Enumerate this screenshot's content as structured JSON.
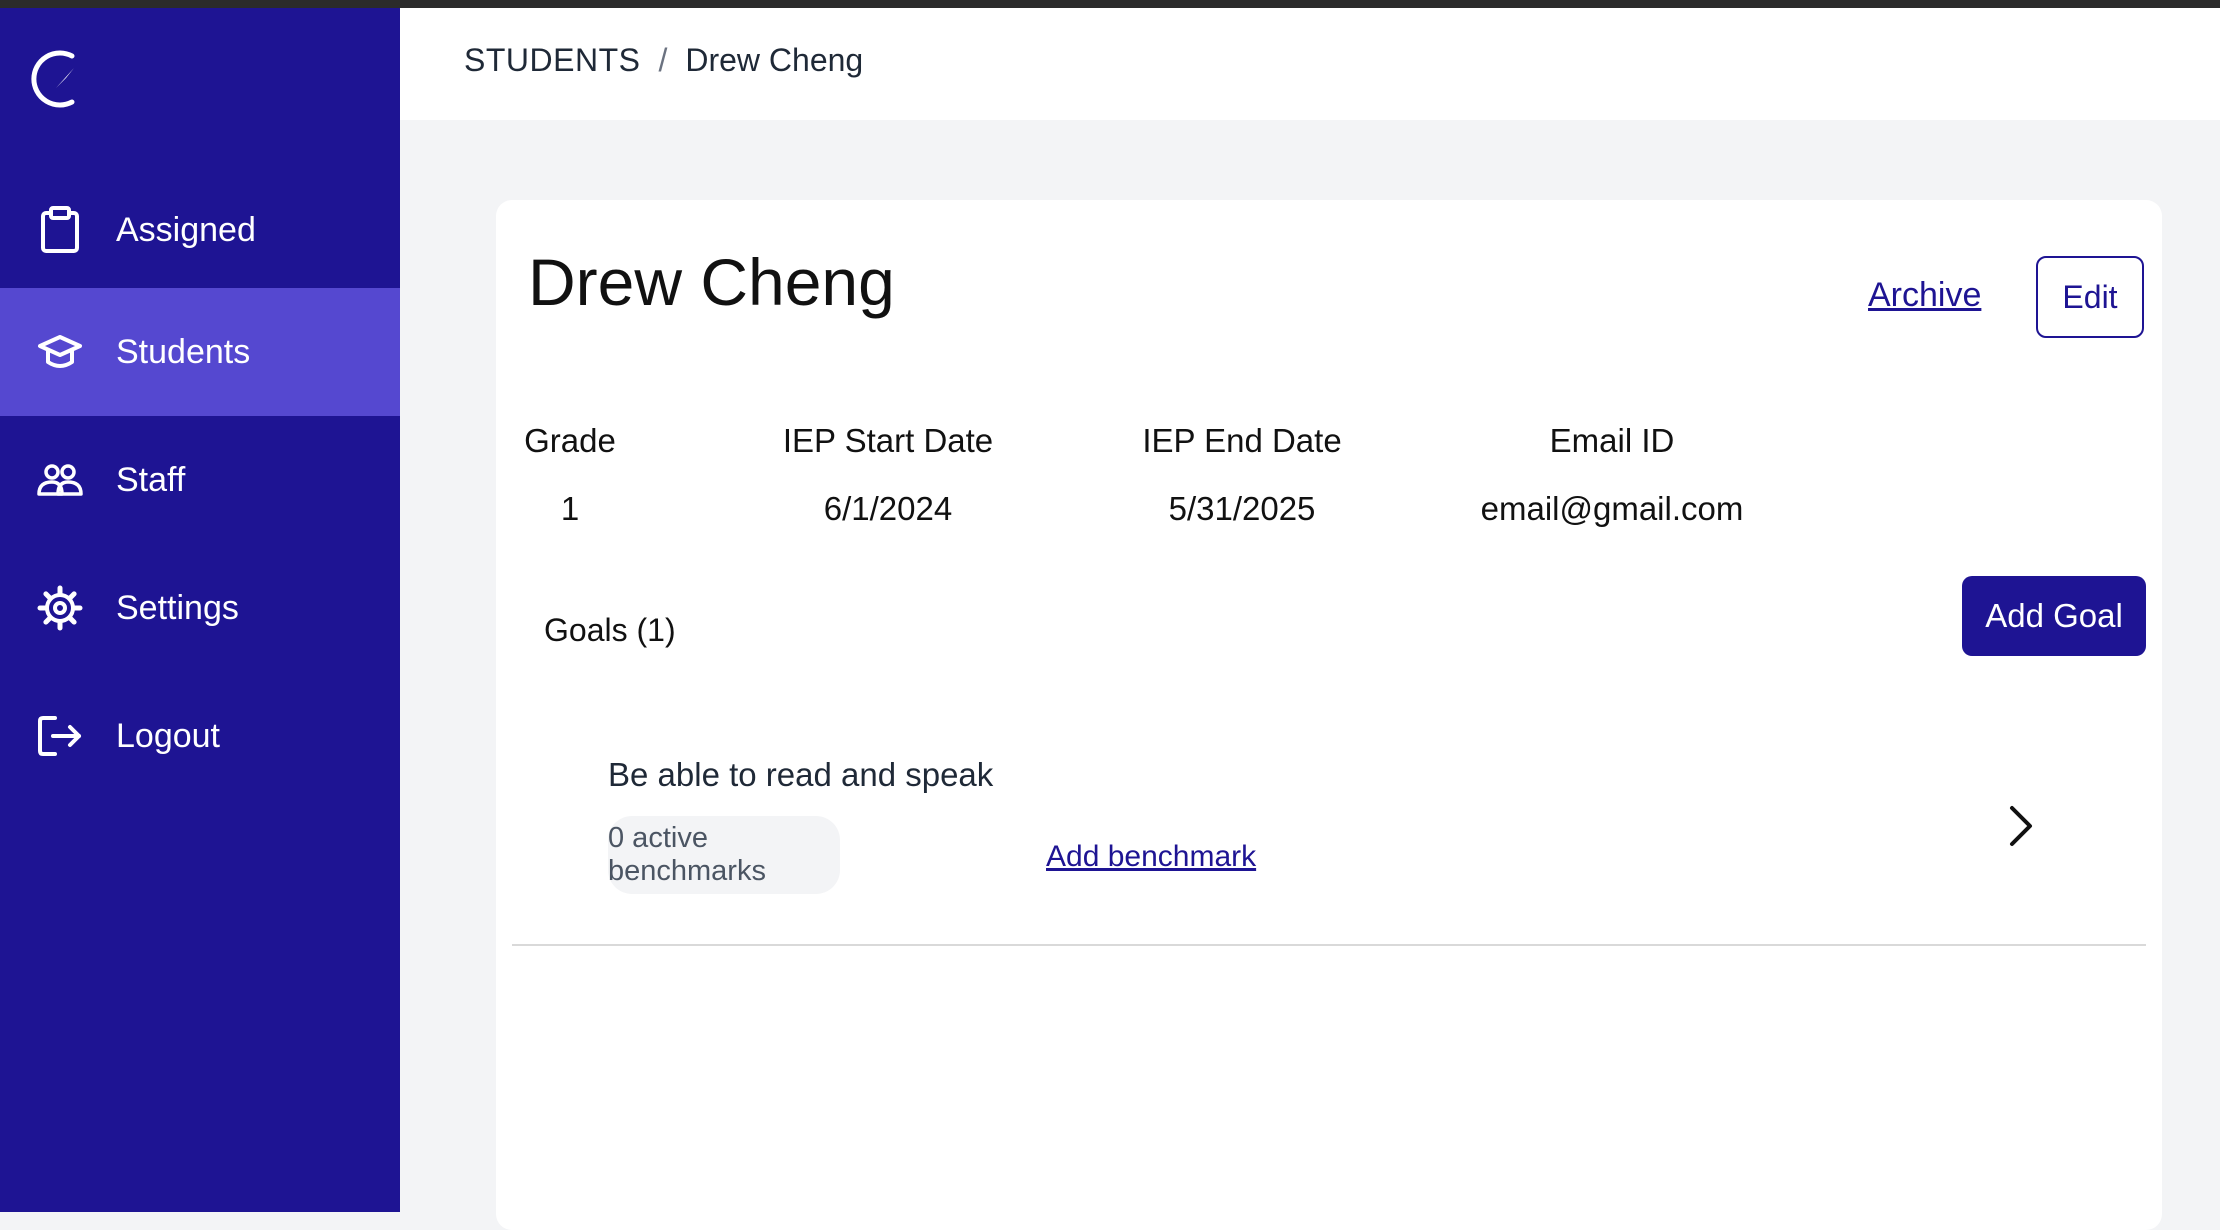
{
  "sidebar": {
    "logo": "compass-logo",
    "items": [
      {
        "label": "Assigned",
        "icon": "clipboard-icon",
        "active": false
      },
      {
        "label": "Students",
        "icon": "graduation-cap-icon",
        "active": true
      },
      {
        "label": "Staff",
        "icon": "users-icon",
        "active": false
      },
      {
        "label": "Settings",
        "icon": "gear-icon",
        "active": false
      },
      {
        "label": "Logout",
        "icon": "logout-icon",
        "active": false
      }
    ]
  },
  "breadcrumb": {
    "root": "STUDENTS",
    "separator": "/",
    "current": "Drew Cheng"
  },
  "student": {
    "name": "Drew Cheng",
    "archive_label": "Archive",
    "edit_label": "Edit",
    "info": {
      "grade_label": "Grade",
      "grade_value": "1",
      "start_label": "IEP Start Date",
      "start_value": "6/1/2024",
      "end_label": "IEP End Date",
      "end_value": "5/31/2025",
      "email_label": "Email ID",
      "email_value": "email@gmail.com"
    }
  },
  "goals": {
    "heading": "Goals (1)",
    "add_label": "Add Goal",
    "items": [
      {
        "title": "Be able to read and speak",
        "badge": "0 active benchmarks",
        "add_benchmark_label": "Add benchmark"
      }
    ]
  },
  "colors": {
    "sidebar": "#1e1493",
    "sidebar_active": "#5548d0",
    "accent": "#1e1493",
    "background": "#f3f4f6"
  }
}
